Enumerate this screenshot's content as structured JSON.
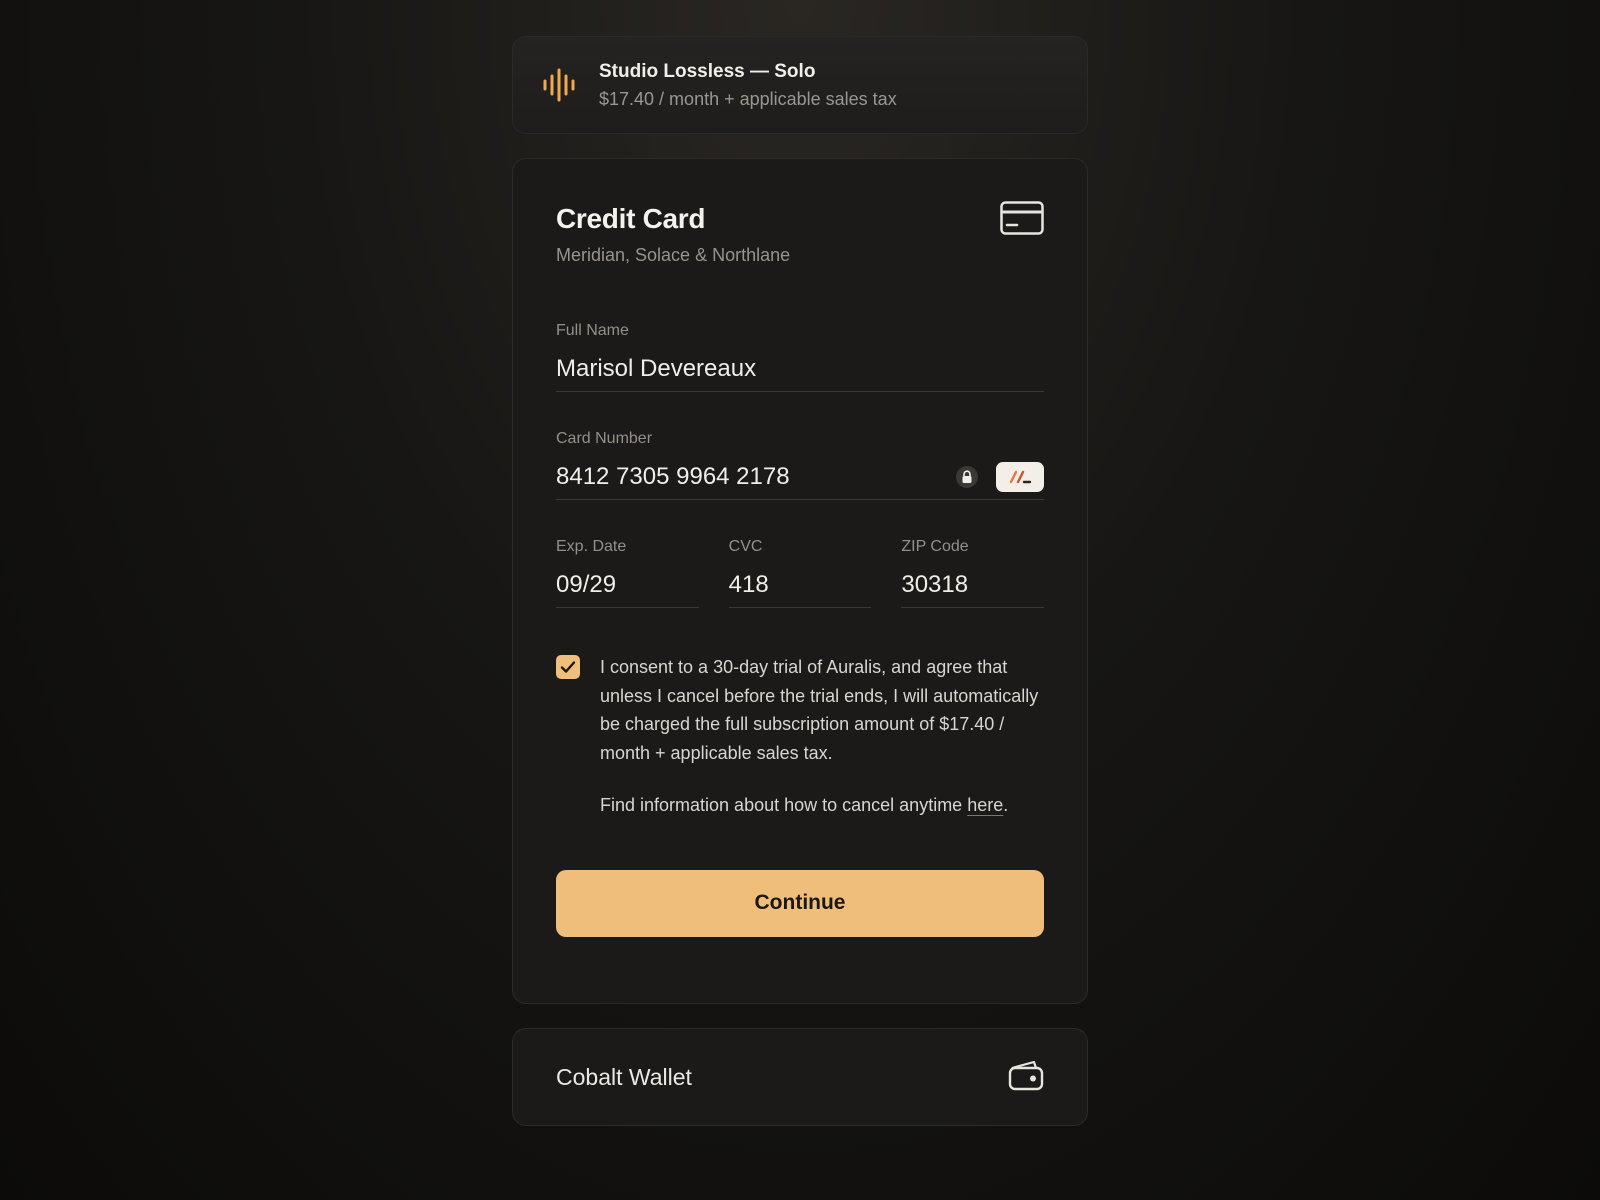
{
  "plan": {
    "icon": "sound-wave-icon",
    "title": "Studio Lossless — Solo",
    "price": "$17.40 / month + applicable sales tax"
  },
  "payment": {
    "title": "Credit Card",
    "issuers": "Meridian, Solace & Northlane",
    "icon": "credit-card-icon",
    "fields": {
      "full_name": {
        "label": "Full Name",
        "value": "Marisol Devereaux"
      },
      "card_number": {
        "label": "Card Number",
        "value": "8412 7305 9964 2178"
      },
      "exp_date": {
        "label": "Exp. Date",
        "value": "09/29"
      },
      "cvc": {
        "label": "CVC",
        "value": "418"
      },
      "zip": {
        "label": "ZIP Code",
        "value": "30318"
      }
    },
    "consent": {
      "checked": true,
      "text": "I consent to a 30-day trial of Auralis, and agree that unless I cancel before the trial ends, I will automatically be charged the full subscription amount of $17.40 / month + applicable sales tax.",
      "cancel_info_prefix": "Find information about how to cancel anytime ",
      "cancel_link": "here",
      "cancel_info_suffix": "."
    },
    "continue_label": "Continue"
  },
  "alt_method": {
    "label": "Cobalt Wallet",
    "icon": "wallet-icon"
  },
  "colors": {
    "accent": "#f0be7b",
    "card_bg": "#1b1a19",
    "page_bg": "#121110"
  }
}
